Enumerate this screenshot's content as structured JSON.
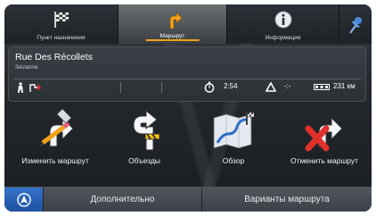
{
  "tabs": [
    {
      "label": "Пункт назначения",
      "icon": "checkered-flag-icon",
      "active": false
    },
    {
      "label": "Маршрут",
      "icon": "route-arrow-icon",
      "active": true
    },
    {
      "label": "Информация",
      "icon": "info-icon",
      "active": false
    }
  ],
  "panel": {
    "street": "Rue Des Récollets",
    "city": "Sézanne",
    "time": "2:54",
    "dash": "-:-",
    "distance": "231 км"
  },
  "actions": [
    {
      "label": "Изменить маршрут",
      "icon": "edit-route-icon"
    },
    {
      "label": "Объезды",
      "icon": "detour-icon"
    },
    {
      "label": "Обзор",
      "icon": "map-overview-icon"
    },
    {
      "label": "Отменить маршрут",
      "icon": "cancel-route-icon"
    }
  ],
  "bottom": {
    "more": "Дополнительно",
    "route_options": "Варианты маршрута"
  },
  "colors": {
    "accent": "#f2a21a",
    "nav_button": "#2a63b8",
    "cancel": "#e0302a"
  }
}
